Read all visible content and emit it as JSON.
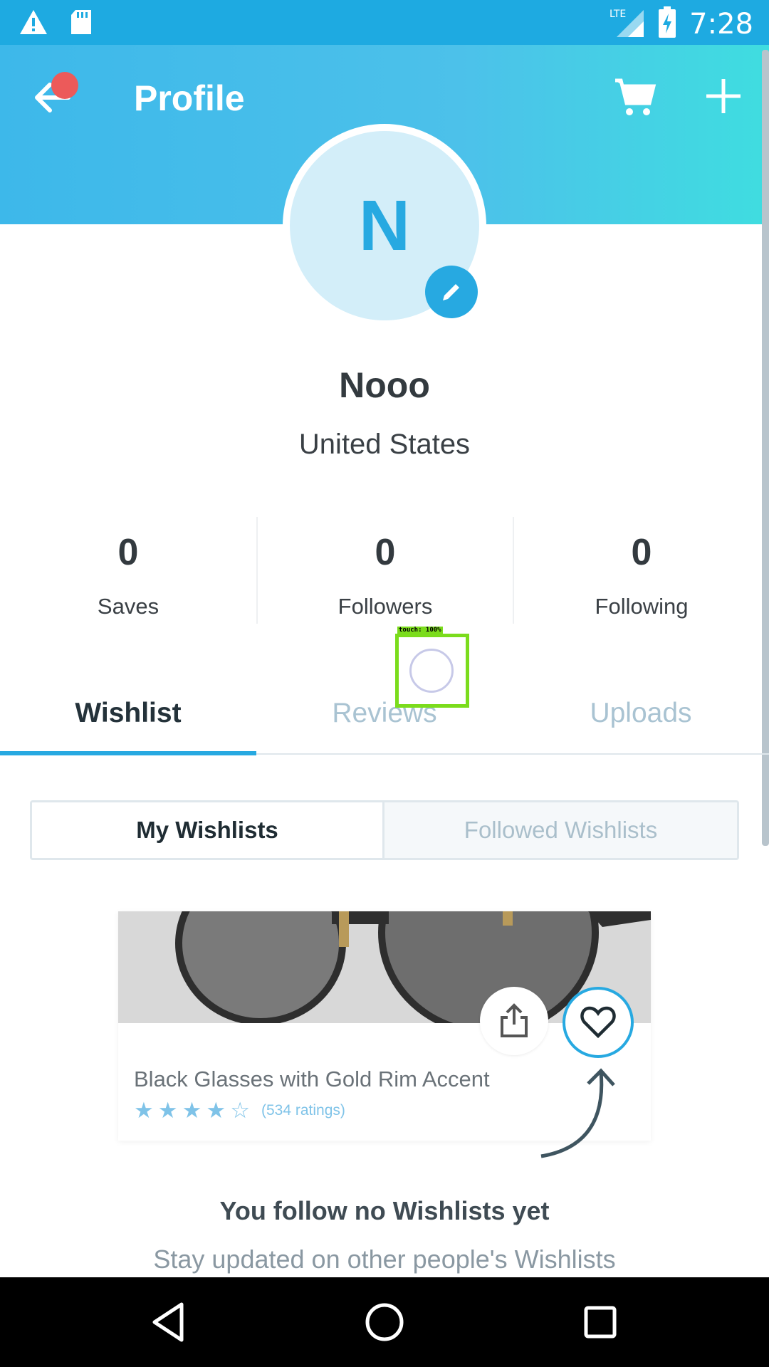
{
  "status_bar": {
    "time": "7:28",
    "icons": [
      "warning-icon",
      "sd-card-icon",
      "lte-signal-icon",
      "battery-charging-icon"
    ],
    "network_label": "LTE"
  },
  "header": {
    "title": "Profile",
    "icons": [
      "back-arrow-icon",
      "cart-icon",
      "plus-icon"
    ],
    "gradient": [
      "#3db8ea",
      "#3fdde0"
    ]
  },
  "profile": {
    "avatar_letter": "N",
    "name": "Nooo",
    "country": "United States"
  },
  "stats": [
    {
      "value": "0",
      "label": "Saves"
    },
    {
      "value": "0",
      "label": "Followers"
    },
    {
      "value": "0",
      "label": "Following"
    }
  ],
  "touch_indicator": {
    "label": "touch: 100%"
  },
  "tabs": [
    {
      "label": "Wishlist",
      "active": true
    },
    {
      "label": "Reviews",
      "active": false
    },
    {
      "label": "Uploads",
      "active": false
    }
  ],
  "segment": {
    "my": "My Wishlists",
    "followed": "Followed Wishlists"
  },
  "card": {
    "title": "Black Glasses with Gold Rim Accent",
    "rating_stars": 4,
    "ratings_text": "(534 ratings)"
  },
  "empty_state": {
    "title": "You follow no Wishlists yet",
    "subtitle": "Stay updated on other people's Wishlists"
  },
  "colors": {
    "accent": "#27a9e1",
    "notification": "#ec5a5a"
  }
}
